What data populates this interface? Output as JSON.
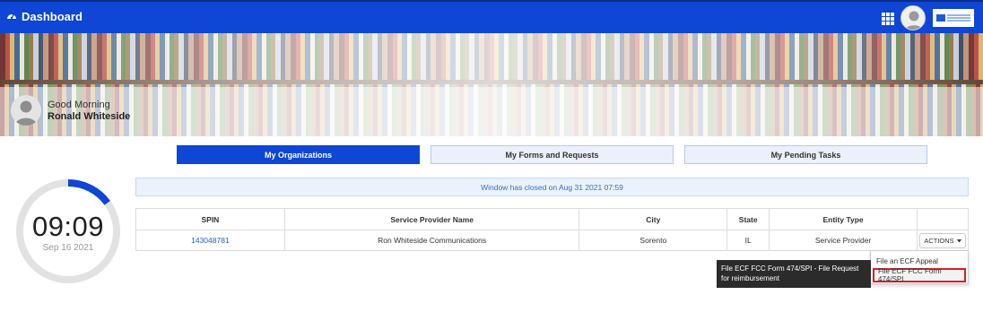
{
  "header": {
    "title": "Dashboard",
    "title_icon": "tachometer-icon",
    "apps_icon": "grid-icon"
  },
  "greeting": {
    "salutation": "Good Morning",
    "name": "Ronald Whiteside"
  },
  "tabs": [
    {
      "label": "My Organizations",
      "active": true
    },
    {
      "label": "My Forms and Requests",
      "active": false
    },
    {
      "label": "My Pending Tasks",
      "active": false
    }
  ],
  "clock": {
    "time": "09:09",
    "date": "Sep 16 2021",
    "progress": 0.15
  },
  "notice": "Window has closed on Aug 31 2021  07:59",
  "table": {
    "columns": [
      "SPIN",
      "Service Provider Name",
      "City",
      "State",
      "Entity Type"
    ],
    "rows": [
      {
        "spin": "143048781",
        "name": "Ron Whiteside Communications",
        "city": "Sorento",
        "state": "IL",
        "entity_type": "Service Provider",
        "actions_label": "ACTIONS"
      }
    ]
  },
  "actions_menu": {
    "items": [
      "File an ECF Appeal",
      "File ECF FCC Form 474/SPI"
    ]
  },
  "tooltip": "File ECF FCC Form 474/SPI - File Request for reimbursement",
  "colors": {
    "primary": "#0e46d6",
    "highlight": "#d71f26",
    "link": "#2060c8"
  }
}
